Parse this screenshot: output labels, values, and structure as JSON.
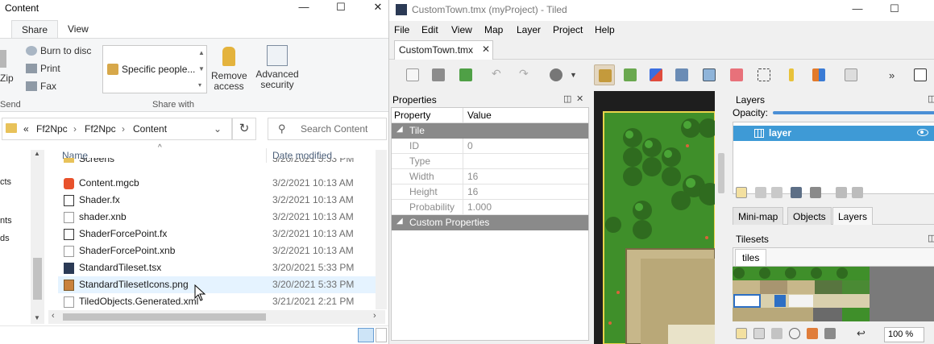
{
  "explorer": {
    "title": "Content",
    "controls": {
      "minimize": "—",
      "maximize": "☐",
      "close": "✕"
    },
    "tabs": [
      {
        "label": "Share",
        "active": true
      },
      {
        "label": "View",
        "active": false
      }
    ],
    "ribbon": {
      "left_partial": {
        "zip": "Zip",
        "send": "Send"
      },
      "burn": "Burn to disc",
      "print": "Print",
      "fax": "Fax",
      "share_with_value": "Specific people...",
      "share_with_group": "Share with",
      "remove_access": "Remove access",
      "advanced_security": "Advanced security"
    },
    "address": {
      "prefix": "«",
      "parts": [
        "Ff2Npc",
        "Ff2Npc",
        "Content"
      ],
      "search_placeholder": "Search Content"
    },
    "nav_labels": [
      "cts",
      "nts",
      "ds"
    ],
    "columns": {
      "name": "Name",
      "date": "Date modified"
    },
    "files": [
      {
        "name": "Screens",
        "date": "3/20/2021 5:33 PM",
        "icon": "folder-icon"
      },
      {
        "name": "Content.mgcb",
        "date": "3/2/2021 10:13 AM",
        "icon": "mgcb-icon"
      },
      {
        "name": "Shader.fx",
        "date": "3/2/2021 10:13 AM",
        "icon": "fx-file-icon"
      },
      {
        "name": "shader.xnb",
        "date": "3/2/2021 10:13 AM",
        "icon": "file-icon"
      },
      {
        "name": "ShaderForcePoint.fx",
        "date": "3/2/2021 10:13 AM",
        "icon": "fx-file-icon"
      },
      {
        "name": "ShaderForcePoint.xnb",
        "date": "3/2/2021 10:13 AM",
        "icon": "file-icon"
      },
      {
        "name": "StandardTileset.tsx",
        "date": "3/20/2021 5:33 PM",
        "icon": "tiled-icon"
      },
      {
        "name": "StandardTilesetIcons.png",
        "date": "3/20/2021 5:33 PM",
        "icon": "image-file-icon",
        "selected": true
      },
      {
        "name": "TiledObjects.Generated.xml",
        "date": "3/21/2021 2:21 PM",
        "icon": "file-icon"
      }
    ]
  },
  "tiled": {
    "title": "CustomTown.tmx (myProject) - Tiled",
    "controls": {
      "minimize": "—",
      "maximize": "☐"
    },
    "menu": [
      {
        "label": "File"
      },
      {
        "label": "Edit"
      },
      {
        "label": "View"
      },
      {
        "label": "Map"
      },
      {
        "label": "Layer"
      },
      {
        "label": "Project"
      },
      {
        "label": "Help"
      }
    ],
    "document_tab": {
      "label": "CustomTown.tmx",
      "close": "✕"
    },
    "toolbar_overflow": "»",
    "properties": {
      "title": "Properties",
      "header": {
        "property": "Property",
        "value": "Value"
      },
      "sections": [
        {
          "label": "Tile",
          "rows": [
            {
              "key": "ID",
              "value": "0"
            },
            {
              "key": "Type",
              "value": ""
            },
            {
              "key": "Width",
              "value": "16"
            },
            {
              "key": "Height",
              "value": "16"
            },
            {
              "key": "Probability",
              "value": "1.000"
            }
          ]
        },
        {
          "label": "Custom Properties",
          "rows": []
        }
      ]
    },
    "layers": {
      "title": "Layers",
      "opacity_label": "Opacity:",
      "layer_name": "layer",
      "tabs": [
        {
          "label": "Mini-map"
        },
        {
          "label": "Objects"
        },
        {
          "label": "Layers",
          "active": true
        }
      ]
    },
    "tilesets": {
      "title": "Tilesets",
      "tab": "tiles",
      "zoom": "100 %"
    }
  }
}
